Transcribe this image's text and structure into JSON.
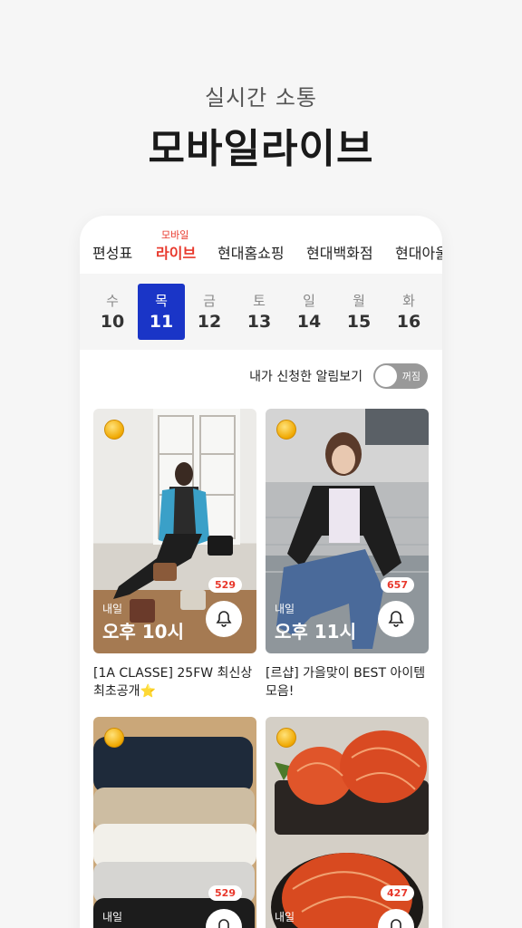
{
  "hero": {
    "subtitle": "실시간 소통",
    "title": "모바일라이브"
  },
  "tabs": [
    {
      "label": "편성표"
    },
    {
      "label": "라이브",
      "sup": "모바일"
    },
    {
      "label": "현대홈쇼핑"
    },
    {
      "label": "현대백화점"
    },
    {
      "label": "현대아울"
    }
  ],
  "days": [
    {
      "dow": "수",
      "num": "10"
    },
    {
      "dow": "목",
      "num": "11"
    },
    {
      "dow": "금",
      "num": "12"
    },
    {
      "dow": "토",
      "num": "13"
    },
    {
      "dow": "일",
      "num": "14"
    },
    {
      "dow": "월",
      "num": "15"
    },
    {
      "dow": "화",
      "num": "16"
    }
  ],
  "alert": {
    "label": "내가 신청한 알림보기",
    "toggle_text": "꺼짐"
  },
  "cards": [
    {
      "when": "내일",
      "time": "오후 10시",
      "count": "529",
      "title": "[1A CLASSE] 25FW 최신상 최초공개⭐"
    },
    {
      "when": "내일",
      "time": "오후 11시",
      "count": "657",
      "title": "[르샵] 가을맞이 BEST 아이템 모음!"
    },
    {
      "when": "내일",
      "count": "529"
    },
    {
      "when": "내일",
      "count": "427"
    }
  ],
  "colors": {
    "accent": "#e8382c",
    "active_day": "#1a35c7"
  }
}
